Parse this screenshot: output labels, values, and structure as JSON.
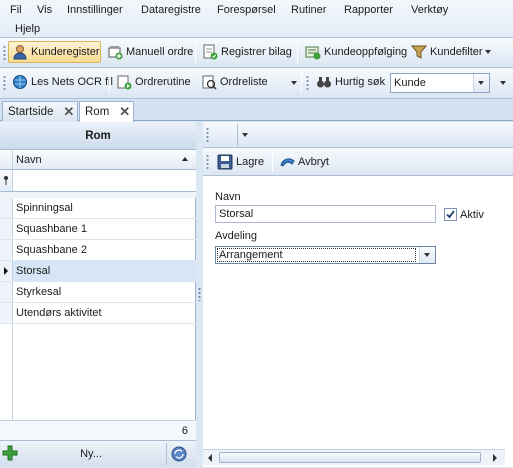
{
  "menu": {
    "items": [
      "Fil",
      "Vis",
      "Innstillinger",
      "Dataregistre",
      "Forespørsel",
      "Rutiner",
      "Rapporter",
      "Verktøy",
      "Hjelp"
    ]
  },
  "toolbar1": {
    "kunderegister": "Kunderegister",
    "manuell_ordre": "Manuell ordre",
    "registrer_bilag": "Registrer bilag",
    "kundeoppfolging": "Kundeoppfølging",
    "kundefilter": "Kundefilter"
  },
  "toolbar2": {
    "les_nets": "Les Nets OCR fil",
    "ordrerutine": "Ordrerutine",
    "ordreliste": "Ordreliste",
    "hurtig_sok": "Hurtig søk",
    "hurtig_sok_value": "Kunde"
  },
  "tabs": [
    {
      "label": "Startside"
    },
    {
      "label": "Rom"
    }
  ],
  "grid": {
    "title": "Rom",
    "column": "Navn",
    "rows": [
      {
        "name": "Spinningsal"
      },
      {
        "name": "Squashbane 1"
      },
      {
        "name": "Squashbane 2"
      },
      {
        "name": "Storsal",
        "selected": true
      },
      {
        "name": "Styrkesal"
      },
      {
        "name": "Utendørs aktivitet"
      }
    ],
    "count": "6",
    "new_label": "Ny..."
  },
  "detail": {
    "lagre": "Lagre",
    "avbryt": "Avbryt",
    "navn_label": "Navn",
    "navn_value": "Storsal",
    "aktiv_label": "Aktiv",
    "aktiv_checked": true,
    "avdeling_label": "Avdeling",
    "avdeling_value": "Arrangement"
  },
  "colors": {
    "accent": "#f7dc94",
    "selection": "#d6e6f6",
    "panel": "#dce7f4"
  }
}
